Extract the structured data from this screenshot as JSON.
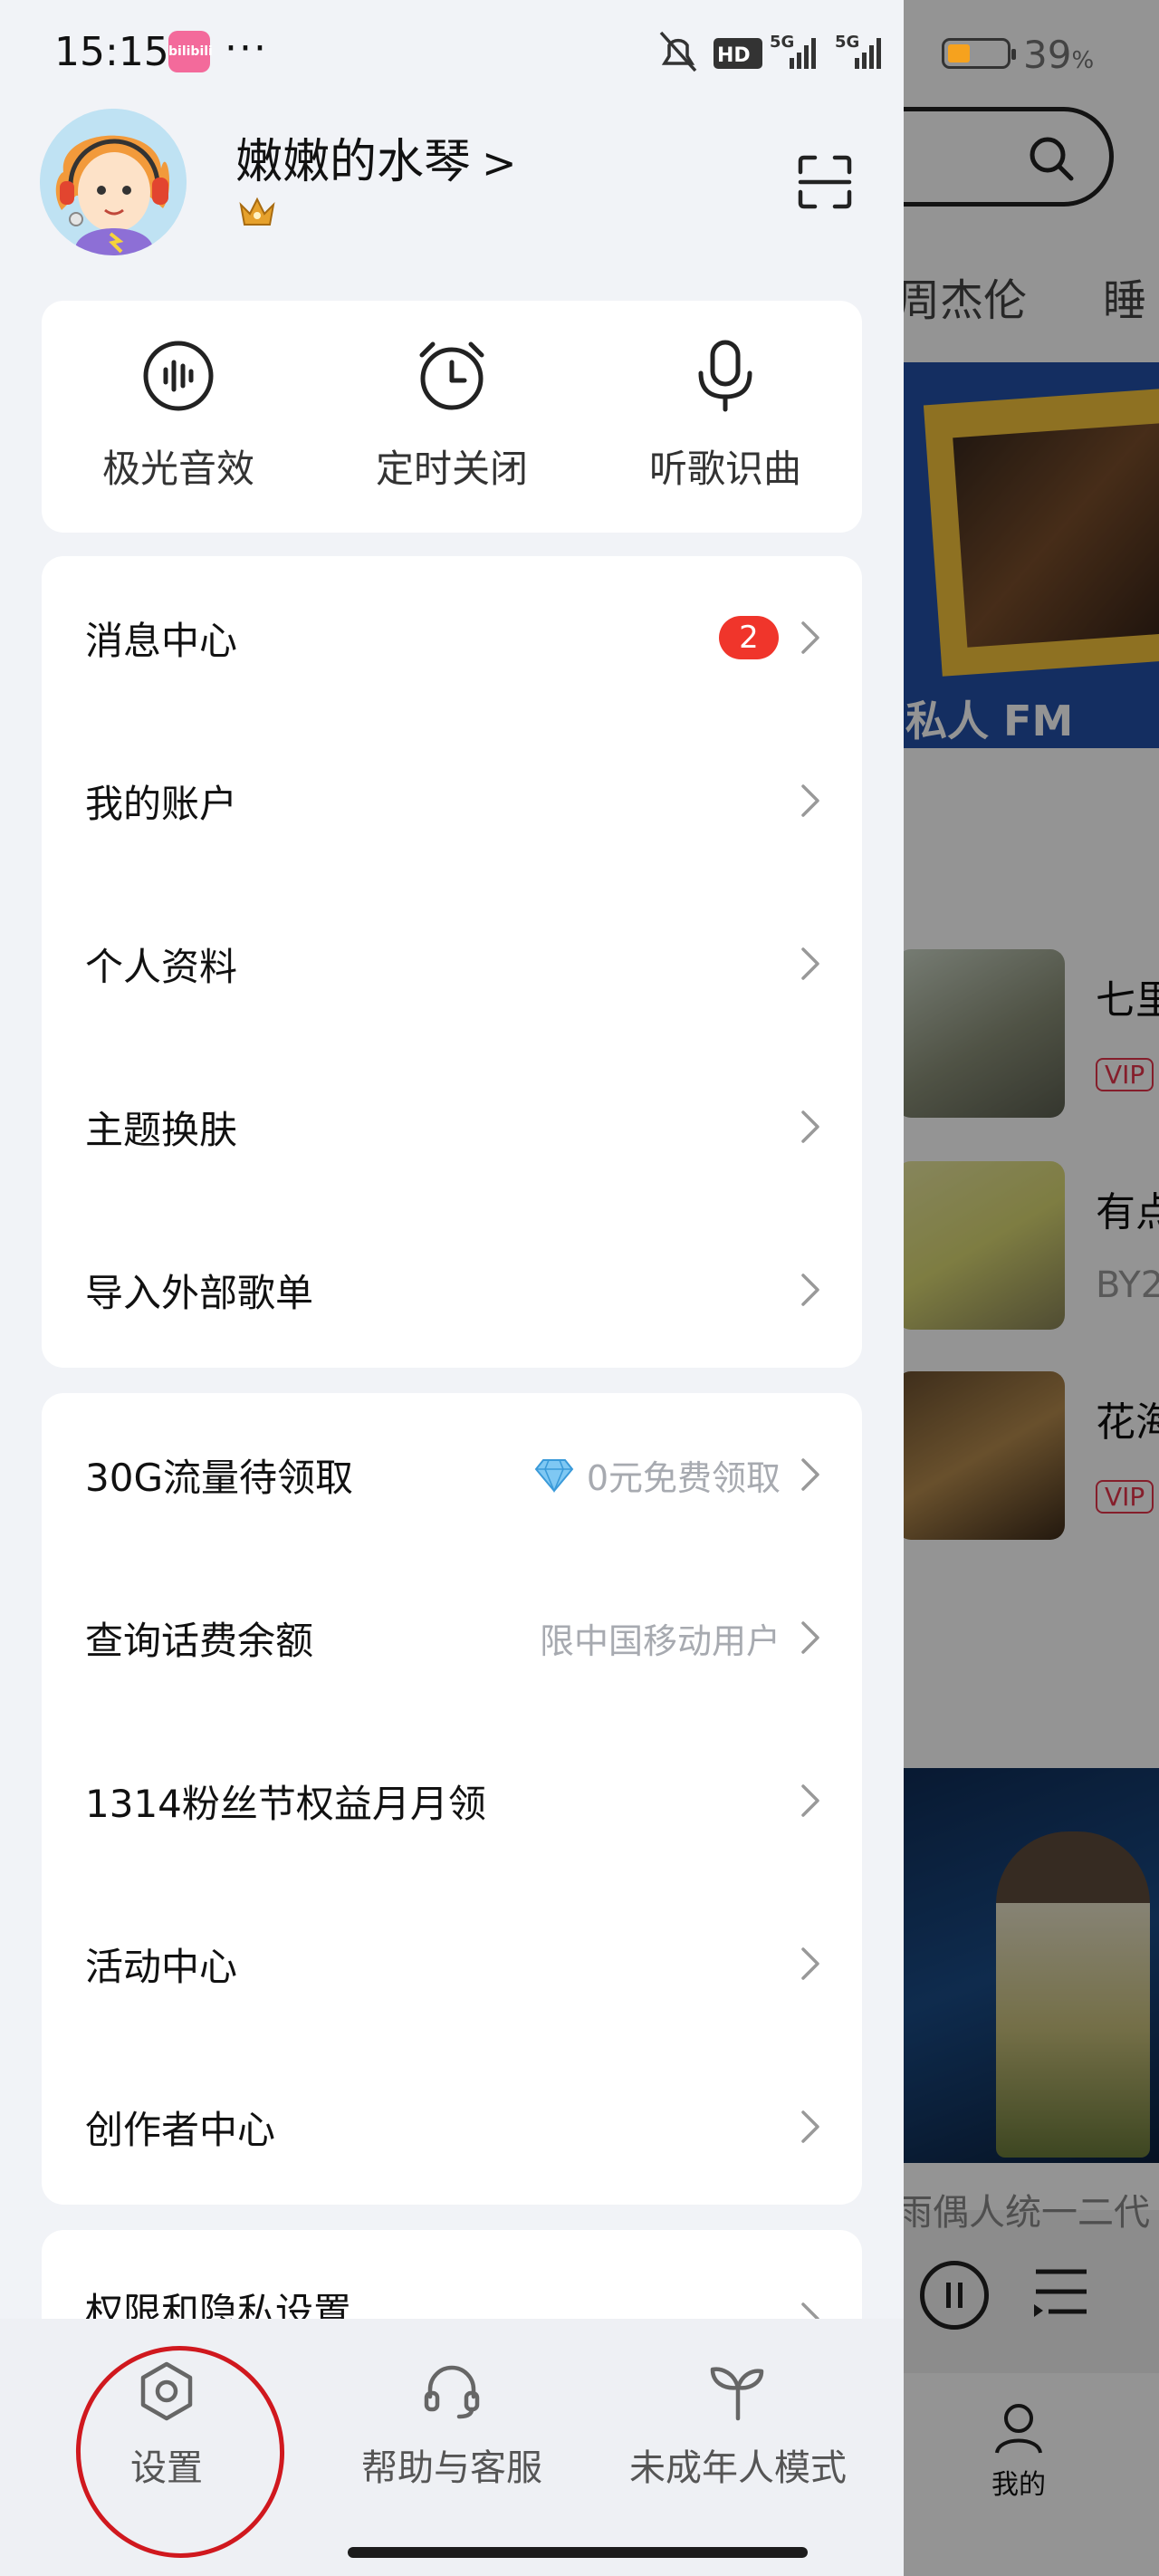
{
  "status_bar": {
    "time": "15:15",
    "app_badge": "bilibili",
    "more": "···",
    "hd": "HD",
    "net1": "5G",
    "net2": "5G",
    "battery_percent": "39",
    "battery_unit": "%",
    "battery_level": 0.39
  },
  "profile": {
    "username": "嫩嫩的水琴",
    "chevron": ">",
    "crown_icon": "crown-icon",
    "scan_icon": "scan-icon"
  },
  "quick_tools": [
    {
      "label": "极光音效",
      "icon": "sound-wave-icon"
    },
    {
      "label": "定时关闭",
      "icon": "alarm-clock-icon"
    },
    {
      "label": "听歌识曲",
      "icon": "microphone-icon"
    }
  ],
  "menu_group_1": [
    {
      "label": "消息中心",
      "badge": "2"
    },
    {
      "label": "我的账户"
    },
    {
      "label": "个人资料"
    },
    {
      "label": "主题换肤"
    },
    {
      "label": "导入外部歌单"
    }
  ],
  "menu_group_2": [
    {
      "label": "30G流量待领取",
      "extra": "0元免费领取",
      "extra_icon": "diamond-icon"
    },
    {
      "label": "查询话费余额",
      "extra": "限中国移动用户"
    },
    {
      "label": "1314粉丝节权益月月领"
    },
    {
      "label": "活动中心"
    },
    {
      "label": "创作者中心"
    }
  ],
  "menu_group_3": [
    {
      "label": "权限和隐私设置"
    }
  ],
  "bottom_nav": [
    {
      "label": "设置",
      "icon": "settings-hexagon-icon"
    },
    {
      "label": "帮助与客服",
      "icon": "headset-icon"
    },
    {
      "label": "未成年人模式",
      "icon": "sprout-icon"
    }
  ],
  "background_app": {
    "tags": [
      "周杰伦",
      "睡"
    ],
    "banner_label": "私人 FM",
    "songs": [
      {
        "title": "七里",
        "tag": "VIP"
      },
      {
        "title": "有点",
        "sub": "BY2"
      },
      {
        "title": "花海",
        "tag": "VIP"
      }
    ],
    "player_caption": "雨偶人统一二代",
    "nav_me": "我的"
  },
  "colors": {
    "accent_red": "#f0352b",
    "annotation_red": "#d0181e",
    "drawer_bg": "#f1f3f7",
    "fm_banner": "#2350a8"
  }
}
